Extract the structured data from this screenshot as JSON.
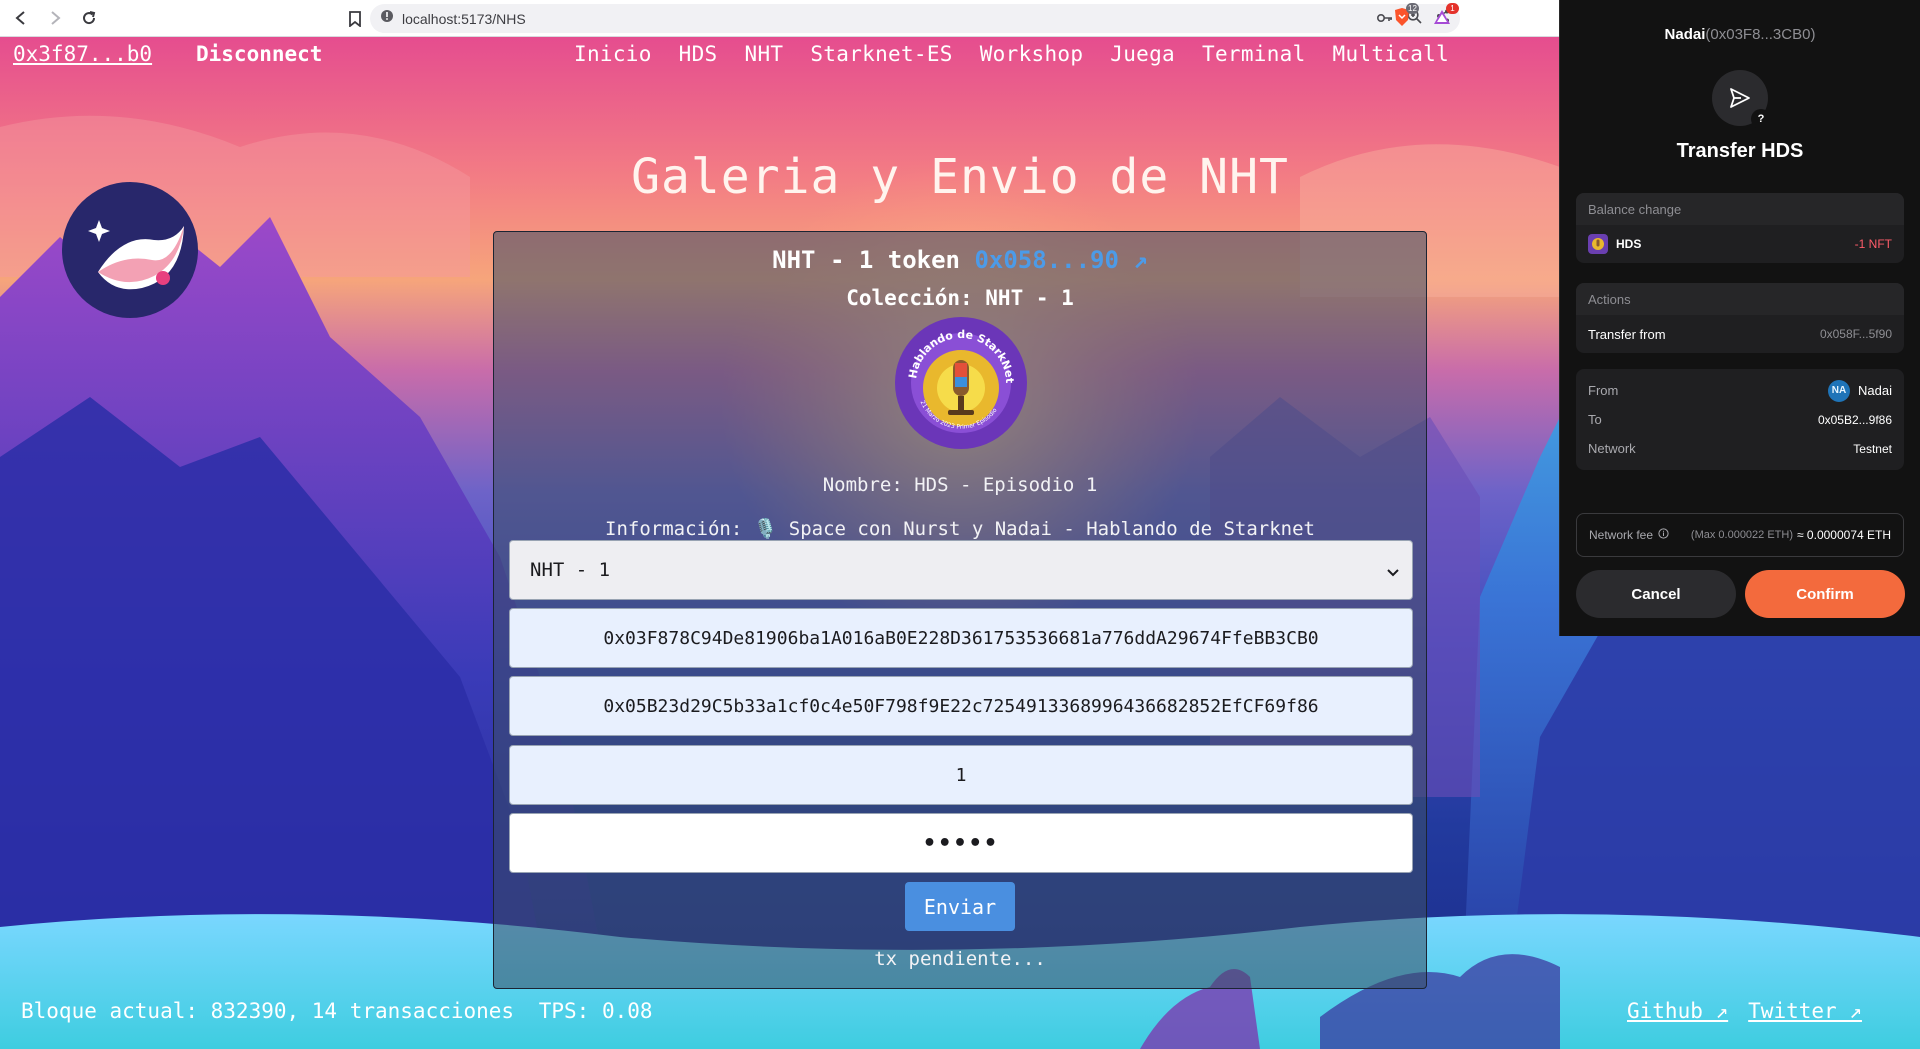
{
  "browser": {
    "url": "localhost:5173/NHS",
    "ext_badges": {
      "brave": "12",
      "alert": "1"
    }
  },
  "nav": {
    "account": "0x3f87...b0",
    "disconnect": "Disconnect",
    "links": [
      "Inicio",
      "HDS",
      "NHT",
      "Starknet-ES",
      "Workshop",
      "Juega",
      "Terminal",
      "Multicall"
    ]
  },
  "page": {
    "title": "Galeria y Envio de NHT"
  },
  "card": {
    "token_heading": "NHT - 1 token",
    "token_link": "0x058...90 ↗",
    "collection": "Colección: NHT - 1",
    "nft_badge_text": "Hablando de StarkNet",
    "nft_badge_subtext": "21 Marzo 2023 Primer Episodio",
    "name": "Nombre: HDS - Episodio 1",
    "info": "Información: 🎙️ Space con Nurst y Nadai - Hablando de Starknet",
    "select_value": "NHT - 1",
    "from_address": "0x03F878C94De81906ba1A016aB0E228D361753536681a776ddA29674FfeBB3CB0",
    "to_address": "0x05B23d29C5b33a1cf0c4e50F798f9E22c725491336899643668285​2EfCF69f86",
    "amount": "1",
    "password_mask": "•••••",
    "send_label": "Enviar",
    "status": "tx pendiente..."
  },
  "footer": {
    "block_info": "Bloque actual: 832390, 14 transacciones",
    "tps": "TPS: 0.08",
    "github": "Github ↗",
    "twitter": "Twitter ↗"
  },
  "wallet": {
    "account_name": "Nadai",
    "account_addr": "(0x03F8...3CB0)",
    "title": "Transfer HDS",
    "balance_header": "Balance change",
    "balance_token": "HDS",
    "balance_change": "-1 NFT",
    "actions_header": "Actions",
    "action_label": "Transfer from",
    "action_value": "0x058F...5f90",
    "from_label": "From",
    "from_avatar": "NA",
    "from_value": "Nadai",
    "to_label": "To",
    "to_value": "0x05B2...9f86",
    "network_label": "Network",
    "network_value": "Testnet",
    "fee_label": "Network fee",
    "fee_max": "(Max 0.000022 ETH)",
    "fee_amount": "≈ 0.0000074 ETH",
    "cancel": "Cancel",
    "confirm": "Confirm"
  },
  "colors": {
    "accent_link": "#4c9be8",
    "send_button": "#4a8fe0",
    "confirm_button": "#f36a3d",
    "negative": "#ff5c6a"
  }
}
